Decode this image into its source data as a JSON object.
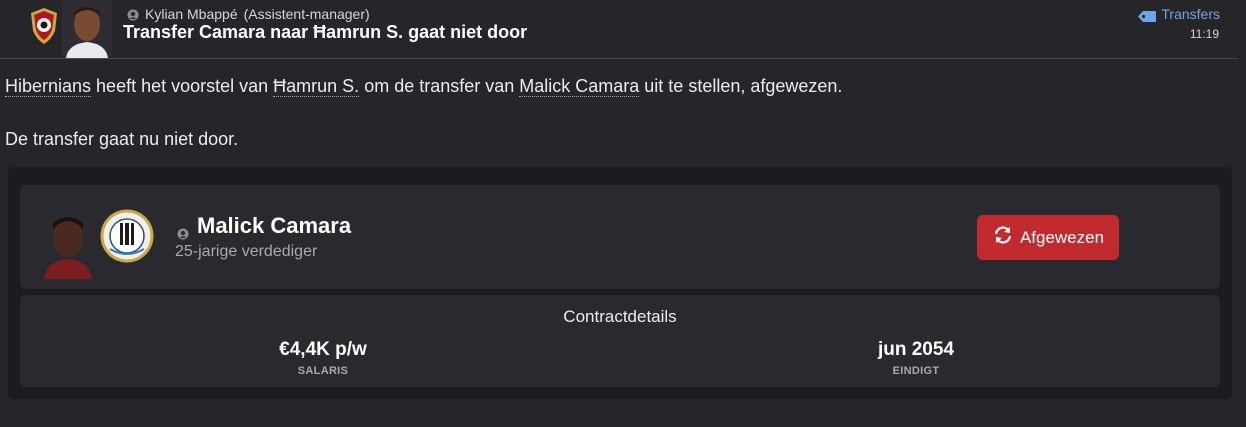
{
  "header": {
    "sender_name": "Kylian Mbappé",
    "sender_role": "(Assistent-manager)",
    "subject": "Transfer Camara naar Ħamrun S. gaat niet door",
    "category": "Transfers",
    "time": "11:19"
  },
  "message": {
    "club_from": "Hibernians",
    "text_1": " heeft het voorstel van ",
    "club_to": "Ħamrun S.",
    "text_2": " om de transfer van ",
    "player_link": "Malick Camara",
    "text_3": " uit te stellen, afgewezen.",
    "paragraph_2": "De transfer gaat nu niet door."
  },
  "player": {
    "name": "Malick Camara",
    "description": "25-jarige verdediger",
    "status": "Afgewezen"
  },
  "contract": {
    "title": "Contractdetails",
    "salary_value": "€4,4K p/w",
    "salary_label": "SALARIS",
    "end_value": "jun 2054",
    "end_label": "EINDIGT"
  },
  "colors": {
    "background": "#26252a",
    "accent_link": "#6ea7e6",
    "status_red": "#c22b2e"
  },
  "icons": {
    "category": "tag-icon",
    "person": "person-icon",
    "status": "refresh-icon"
  }
}
